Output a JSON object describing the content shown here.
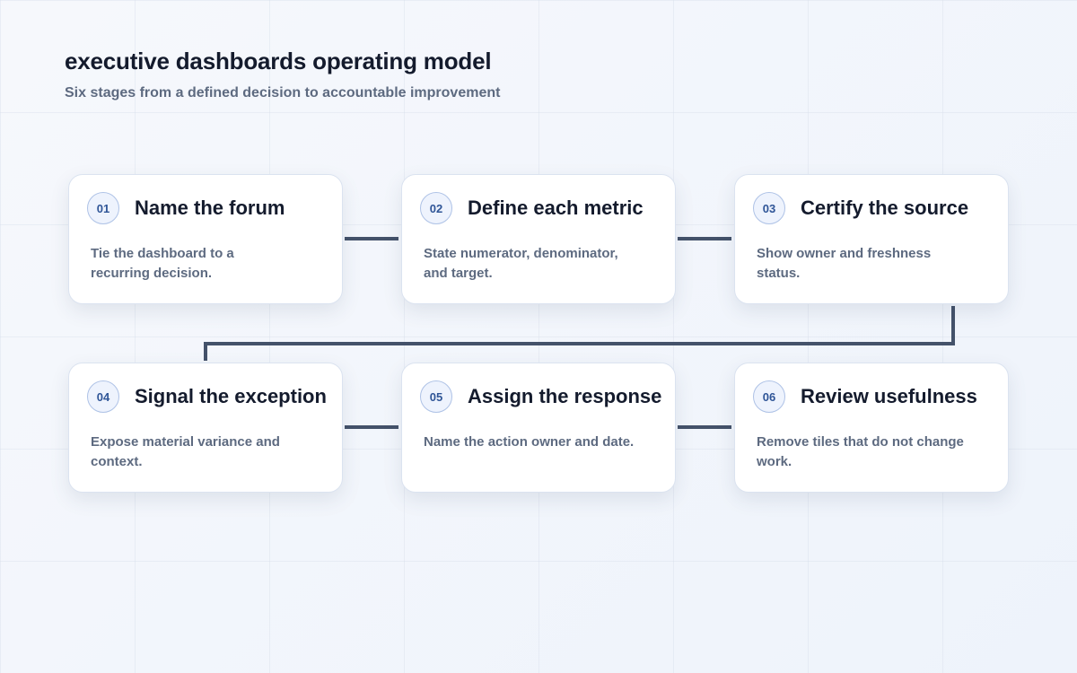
{
  "header": {
    "title": "executive dashboards operating model",
    "subtitle": "Six stages from a defined decision to accountable improvement"
  },
  "stages": [
    {
      "number": "01",
      "title": "Name the forum",
      "description": "Tie the dashboard to a recurring decision."
    },
    {
      "number": "02",
      "title": "Define each metric",
      "description": "State numerator, denominator, and target."
    },
    {
      "number": "03",
      "title": "Certify the source",
      "description": "Show owner and freshness status."
    },
    {
      "number": "04",
      "title": "Signal the exception",
      "description": "Expose material variance and context."
    },
    {
      "number": "05",
      "title": "Assign the response",
      "description": "Name the action owner and date."
    },
    {
      "number": "06",
      "title": "Review usefulness",
      "description": "Remove tiles that do not change work."
    }
  ],
  "colors": {
    "connector": "#44526a",
    "badge_text": "#2f5597",
    "title_text": "#141b2d",
    "body_text": "#5d6a80"
  }
}
